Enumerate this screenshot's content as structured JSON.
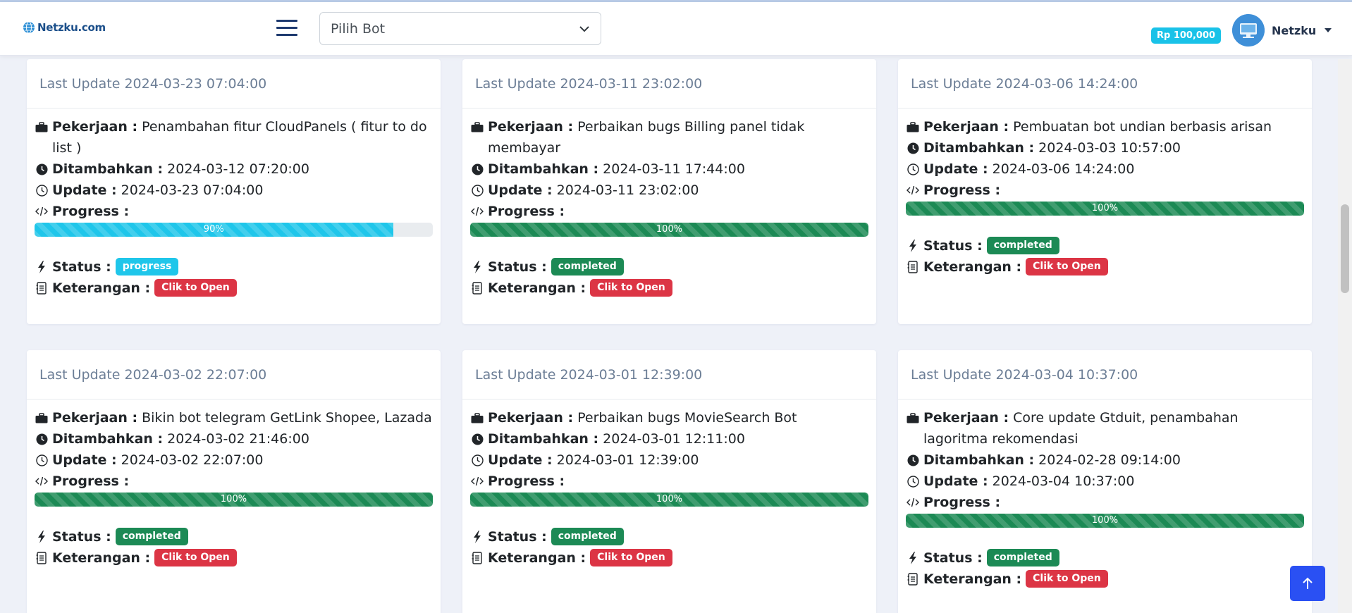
{
  "brand": {
    "name": "Netzku.com"
  },
  "header": {
    "bot_select": {
      "selected": "Pilih Bot"
    },
    "balance": "Rp 100,000",
    "user": {
      "name": "Netzku"
    }
  },
  "labels": {
    "pekerjaan": "Pekerjaan :",
    "ditambahkan": "Ditambahkan :",
    "update": "Update :",
    "progress": "Progress :",
    "status": "Status :",
    "keterangan": "Keterangan :",
    "open_button": "Clik to Open"
  },
  "colors": {
    "completed": "#1c8a55",
    "progress": "#1fc6ea",
    "open_button": "#dc3545",
    "scroll_top": "#2a50f3"
  },
  "cards": [
    {
      "header": "Last Update 2024-03-23 07:04:00",
      "pekerjaan": "Penambahan fitur CloudPanels ( fitur to do list )",
      "ditambahkan": "2024-03-12 07:20:00",
      "update": "2024-03-23 07:04:00",
      "progress_value": 0.9,
      "progress_label": "90%",
      "status": "progress"
    },
    {
      "header": "Last Update 2024-03-11 23:02:00",
      "pekerjaan": "Perbaikan bugs Billing panel tidak membayar",
      "ditambahkan": "2024-03-11 17:44:00",
      "update": "2024-03-11 23:02:00",
      "progress_value": 1.0,
      "progress_label": "100%",
      "status": "completed"
    },
    {
      "header": "Last Update 2024-03-06 14:24:00",
      "pekerjaan": "Pembuatan bot undian berbasis arisan",
      "ditambahkan": "2024-03-03 10:57:00",
      "update": "2024-03-06 14:24:00",
      "progress_value": 1.0,
      "progress_label": "100%",
      "status": "completed"
    },
    {
      "header": "Last Update 2024-03-02 22:07:00",
      "pekerjaan": "Bikin bot telegram GetLink Shopee, Lazada",
      "ditambahkan": "2024-03-02 21:46:00",
      "update": "2024-03-02 22:07:00",
      "progress_value": 1.0,
      "progress_label": "100%",
      "status": "completed"
    },
    {
      "header": "Last Update 2024-03-01 12:39:00",
      "pekerjaan": "Perbaikan bugs MovieSearch Bot",
      "ditambahkan": "2024-03-01 12:11:00",
      "update": "2024-03-01 12:39:00",
      "progress_value": 1.0,
      "progress_label": "100%",
      "status": "completed"
    },
    {
      "header": "Last Update 2024-03-04 10:37:00",
      "pekerjaan": "Core update Gtduit, penambahan lagoritma rekomendasi",
      "ditambahkan": "2024-02-28 09:14:00",
      "update": "2024-03-04 10:37:00",
      "progress_value": 1.0,
      "progress_label": "100%",
      "status": "completed"
    }
  ]
}
